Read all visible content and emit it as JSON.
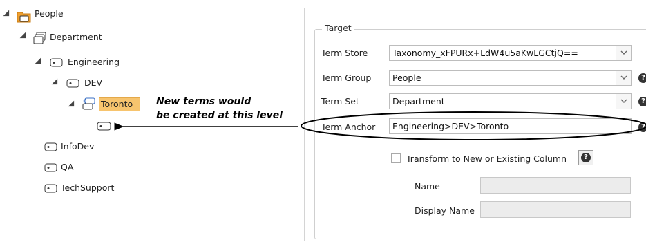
{
  "tree": {
    "people": "People",
    "department": "Department",
    "engineering": "Engineering",
    "dev": "DEV",
    "toronto": "Toronto",
    "infodev": "InfoDev",
    "qa": "QA",
    "techsupport": "TechSupport"
  },
  "annotation": {
    "line1": "New terms would",
    "line2": "be created at this level"
  },
  "target": {
    "legend": "Target",
    "term_store_label": "Term Store",
    "term_store_value": "Taxonomy_xFPURx+LdW4u5aKwLGCtjQ==",
    "term_group_label": "Term Group",
    "term_group_value": "People",
    "term_set_label": "Term Set",
    "term_set_value": "Department",
    "term_anchor_label": "Term Anchor",
    "term_anchor_value": "Engineering>DEV>Toronto",
    "transform_label": "Transform to New or Existing Column",
    "name_label": "Name",
    "display_name_label": "Display Name",
    "help_glyph": "?"
  },
  "colors": {
    "selection": "#f7c46e",
    "folder": "#f0a030"
  }
}
